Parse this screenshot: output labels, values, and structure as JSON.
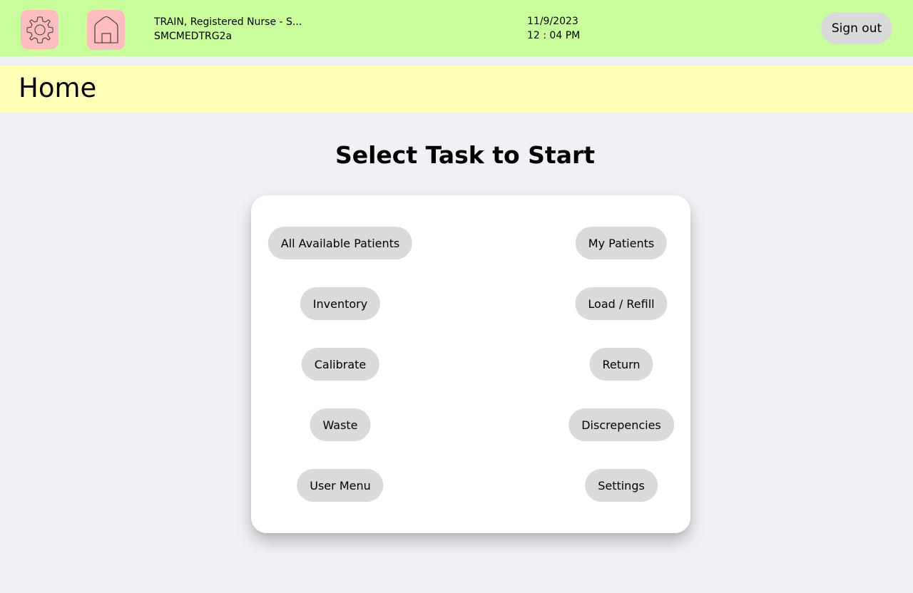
{
  "header": {
    "user_name": "TRAIN, Registered Nurse - S...",
    "station_id": "SMCMEDTRG2a",
    "date": "11/9/2023",
    "time": "12 : 04 PM",
    "signout_label": "Sign out",
    "icons": [
      "gear-icon",
      "home-icon"
    ]
  },
  "page": {
    "title": "Home"
  },
  "main": {
    "heading": "Select Task to Start",
    "left_tasks": [
      "All Available Patients",
      "Inventory",
      "Calibrate",
      "Waste",
      "User Menu"
    ],
    "right_tasks": [
      "My Patients",
      "Load / Refill",
      "Return",
      "Discrepencies",
      "Settings"
    ]
  },
  "colors": {
    "header_bg": "#c8ff9c",
    "page_bar_bg": "#ffffb8",
    "icon_bg": "#ffbdbf",
    "button_bg": "#dadada",
    "page_bg": "#f0f1f5"
  }
}
